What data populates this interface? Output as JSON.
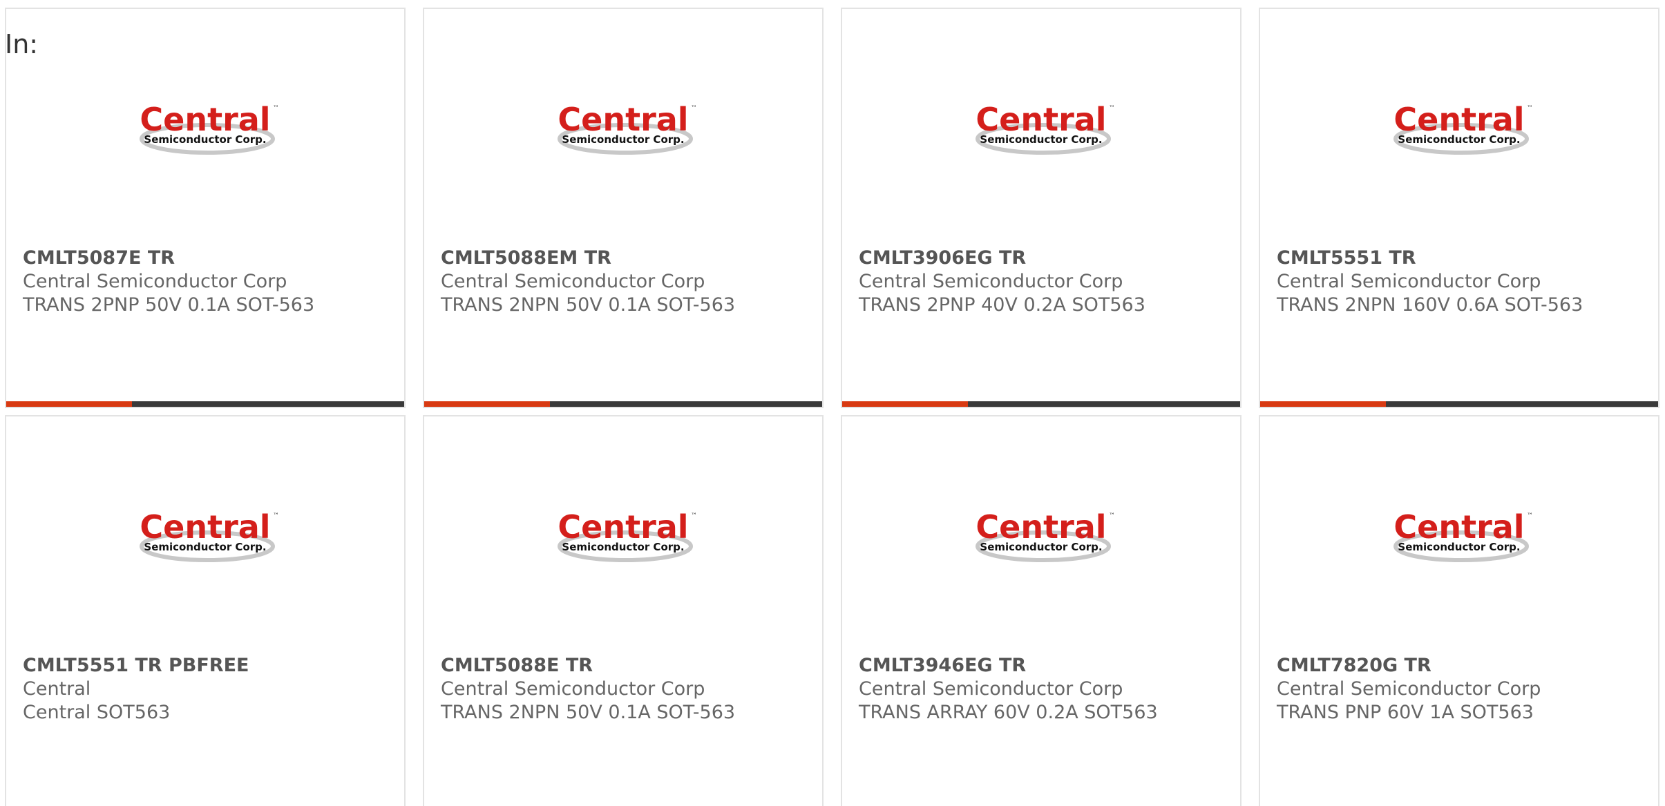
{
  "filter_label": "In:",
  "brand": {
    "logo_text": "Central",
    "logo_tm": "™",
    "logo_sub": "Semiconductor Corp.",
    "logo_red": "#d41f1b",
    "logo_grey": "#9a9a9a",
    "bar_accent": "#d83a12",
    "bar_dark": "#3a3a3a"
  },
  "products": [
    {
      "part": "CMLT5087E TR",
      "manufacturer": "Central Semiconductor Corp",
      "description": "TRANS 2PNP 50V 0.1A SOT-563"
    },
    {
      "part": "CMLT5088EM TR",
      "manufacturer": "Central Semiconductor Corp",
      "description": "TRANS 2NPN 50V 0.1A SOT-563"
    },
    {
      "part": "CMLT3906EG TR",
      "manufacturer": "Central Semiconductor Corp",
      "description": "TRANS 2PNP 40V 0.2A SOT563"
    },
    {
      "part": "CMLT5551 TR",
      "manufacturer": "Central Semiconductor Corp",
      "description": "TRANS 2NPN 160V 0.6A SOT-563"
    },
    {
      "part": "CMLT5551 TR PBFREE",
      "manufacturer": "Central",
      "description": "Central SOT563"
    },
    {
      "part": "CMLT5088E TR",
      "manufacturer": "Central Semiconductor Corp",
      "description": "TRANS 2NPN 50V 0.1A SOT-563"
    },
    {
      "part": "CMLT3946EG TR",
      "manufacturer": "Central Semiconductor Corp",
      "description": "TRANS ARRAY 60V 0.2A SOT563"
    },
    {
      "part": "CMLT7820G TR",
      "manufacturer": "Central Semiconductor Corp",
      "description": "TRANS PNP 60V 1A SOT563"
    }
  ]
}
